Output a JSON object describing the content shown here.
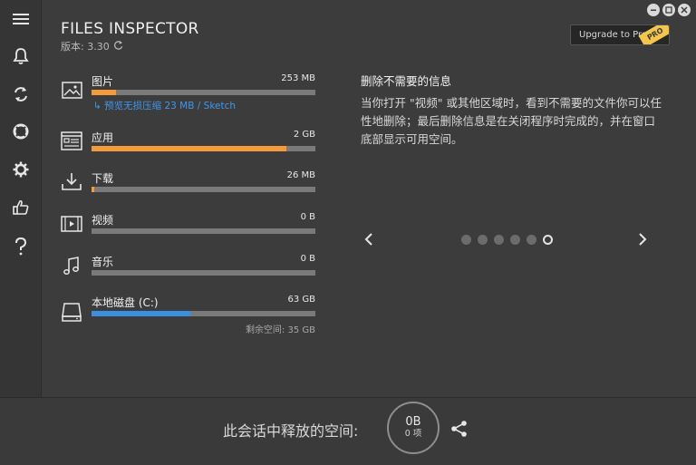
{
  "app": {
    "title": "FILES INSPECTOR",
    "version": "版本: 3.30",
    "upgrade_label": "Upgrade to Pro",
    "pro_badge": "PRO"
  },
  "sidebar": {
    "items": [
      {
        "icon": "menu-icon"
      },
      {
        "icon": "bell-icon"
      },
      {
        "icon": "refresh-icon"
      },
      {
        "icon": "lifebuoy-icon"
      },
      {
        "icon": "gear-icon"
      },
      {
        "icon": "thumbs-up-icon"
      },
      {
        "icon": "help-icon"
      }
    ]
  },
  "categories": [
    {
      "name": "图片",
      "size": "253 MB",
      "fill": 0.11,
      "color": "#f39a3a",
      "sub_link": "预览无损压缩 23 MB / Sketch",
      "icon": "image-icon"
    },
    {
      "name": "应用",
      "size": "2 GB",
      "fill": 0.87,
      "color": "#f39a3a",
      "icon": "apps-icon"
    },
    {
      "name": "下载",
      "size": "26 MB",
      "fill": 0.012,
      "color": "#f39a3a",
      "icon": "download-icon"
    },
    {
      "name": "视频",
      "size": "0 B",
      "fill": 0,
      "color": "#f39a3a",
      "icon": "video-icon"
    },
    {
      "name": "音乐",
      "size": "0 B",
      "fill": 0,
      "color": "#f39a3a",
      "icon": "music-icon"
    }
  ],
  "disk": {
    "name": "本地磁盘 (C:)",
    "size": "63 GB",
    "fill": 0.44,
    "color": "#3a8fe0",
    "remaining": "剩余空间: 35 GB",
    "icon": "drive-icon"
  },
  "info": {
    "title": "删除不需要的信息",
    "body": "当你打开 \"视频\" 或其他区域时，看到不需要的文件你可以任性地删除；最后删除信息是在关闭程序时完成的，并在窗口底部显示可用空间。"
  },
  "carousel": {
    "total": 6,
    "active_index": 5
  },
  "footer": {
    "label": "此会话中释放的空间:",
    "freed": "0B",
    "items": "0 项"
  }
}
